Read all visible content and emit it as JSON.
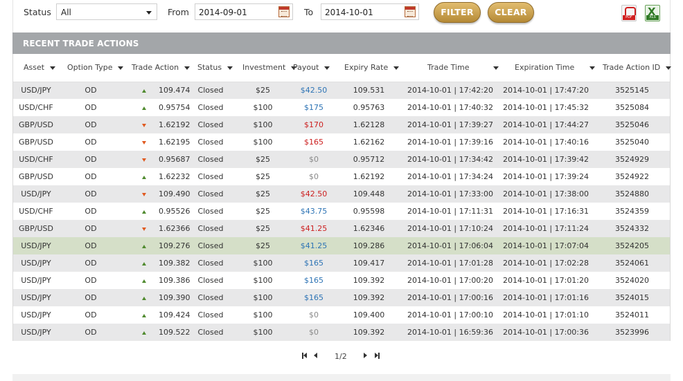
{
  "filters": {
    "status_label": "Status",
    "status_value": "All",
    "from_label": "From",
    "from_value": "2014-09-01",
    "to_label": "To",
    "to_value": "2014-10-01",
    "filter_button": "FILTER",
    "clear_button": "CLEAR",
    "pdf_icon_text": "PDF",
    "xls_icon_text": "XLS"
  },
  "section": {
    "title": "RECENT TRADE ACTIONS"
  },
  "columns": [
    "Asset",
    "Option Type",
    "Trade Action",
    "Status",
    "Investment",
    "Payout",
    "Expiry Rate",
    "Trade Time",
    "Expiration Time",
    "Trade Action ID"
  ],
  "rows": [
    {
      "asset": "USD/JPY",
      "option_type": "OD",
      "direction": "up",
      "trade_action": "109.474",
      "status": "Closed",
      "investment": "$25",
      "payout": "$42.50",
      "payout_color": "blue",
      "expiry_rate": "109.531",
      "trade_time": "2014-10-01 | 17:42:20",
      "expiration_time": "2014-10-01 | 17:47:20",
      "id": "3525145"
    },
    {
      "asset": "USD/CHF",
      "option_type": "OD",
      "direction": "up",
      "trade_action": "0.95754",
      "status": "Closed",
      "investment": "$100",
      "payout": "$175",
      "payout_color": "blue",
      "expiry_rate": "0.95763",
      "trade_time": "2014-10-01 | 17:40:32",
      "expiration_time": "2014-10-01 | 17:45:32",
      "id": "3525084"
    },
    {
      "asset": "GBP/USD",
      "option_type": "OD",
      "direction": "down",
      "trade_action": "1.62192",
      "status": "Closed",
      "investment": "$100",
      "payout": "$170",
      "payout_color": "red",
      "expiry_rate": "1.62128",
      "trade_time": "2014-10-01 | 17:39:27",
      "expiration_time": "2014-10-01 | 17:44:27",
      "id": "3525046"
    },
    {
      "asset": "GBP/USD",
      "option_type": "OD",
      "direction": "down",
      "trade_action": "1.62195",
      "status": "Closed",
      "investment": "$100",
      "payout": "$165",
      "payout_color": "red",
      "expiry_rate": "1.62162",
      "trade_time": "2014-10-01 | 17:39:16",
      "expiration_time": "2014-10-01 | 17:40:16",
      "id": "3525040"
    },
    {
      "asset": "USD/CHF",
      "option_type": "OD",
      "direction": "down",
      "trade_action": "0.95687",
      "status": "Closed",
      "investment": "$25",
      "payout": "$0",
      "payout_color": "gray",
      "expiry_rate": "0.95712",
      "trade_time": "2014-10-01 | 17:34:42",
      "expiration_time": "2014-10-01 | 17:39:42",
      "id": "3524929"
    },
    {
      "asset": "GBP/USD",
      "option_type": "OD",
      "direction": "up",
      "trade_action": "1.62232",
      "status": "Closed",
      "investment": "$25",
      "payout": "$0",
      "payout_color": "gray",
      "expiry_rate": "1.62192",
      "trade_time": "2014-10-01 | 17:34:24",
      "expiration_time": "2014-10-01 | 17:39:24",
      "id": "3524922"
    },
    {
      "asset": "USD/JPY",
      "option_type": "OD",
      "direction": "down",
      "trade_action": "109.490",
      "status": "Closed",
      "investment": "$25",
      "payout": "$42.50",
      "payout_color": "red",
      "expiry_rate": "109.448",
      "trade_time": "2014-10-01 | 17:33:00",
      "expiration_time": "2014-10-01 | 17:38:00",
      "id": "3524880"
    },
    {
      "asset": "USD/CHF",
      "option_type": "OD",
      "direction": "up",
      "trade_action": "0.95526",
      "status": "Closed",
      "investment": "$25",
      "payout": "$43.75",
      "payout_color": "blue",
      "expiry_rate": "0.95598",
      "trade_time": "2014-10-01 | 17:11:31",
      "expiration_time": "2014-10-01 | 17:16:31",
      "id": "3524359"
    },
    {
      "asset": "GBP/USD",
      "option_type": "OD",
      "direction": "down",
      "trade_action": "1.62366",
      "status": "Closed",
      "investment": "$25",
      "payout": "$41.25",
      "payout_color": "red",
      "expiry_rate": "1.62346",
      "trade_time": "2014-10-01 | 17:10:24",
      "expiration_time": "2014-10-01 | 17:11:24",
      "id": "3524332"
    },
    {
      "asset": "USD/JPY",
      "option_type": "OD",
      "direction": "up",
      "trade_action": "109.276",
      "status": "Closed",
      "investment": "$25",
      "payout": "$41.25",
      "payout_color": "blue",
      "expiry_rate": "109.286",
      "trade_time": "2014-10-01 | 17:06:04",
      "expiration_time": "2014-10-01 | 17:07:04",
      "id": "3524205",
      "highlighted": true
    },
    {
      "asset": "USD/JPY",
      "option_type": "OD",
      "direction": "up",
      "trade_action": "109.382",
      "status": "Closed",
      "investment": "$100",
      "payout": "$165",
      "payout_color": "blue",
      "expiry_rate": "109.417",
      "trade_time": "2014-10-01 | 17:01:28",
      "expiration_time": "2014-10-01 | 17:02:28",
      "id": "3524061"
    },
    {
      "asset": "USD/JPY",
      "option_type": "OD",
      "direction": "up",
      "trade_action": "109.386",
      "status": "Closed",
      "investment": "$100",
      "payout": "$165",
      "payout_color": "blue",
      "expiry_rate": "109.392",
      "trade_time": "2014-10-01 | 17:00:20",
      "expiration_time": "2014-10-01 | 17:01:20",
      "id": "3524020"
    },
    {
      "asset": "USD/JPY",
      "option_type": "OD",
      "direction": "up",
      "trade_action": "109.390",
      "status": "Closed",
      "investment": "$100",
      "payout": "$165",
      "payout_color": "blue",
      "expiry_rate": "109.392",
      "trade_time": "2014-10-01 | 17:00:16",
      "expiration_time": "2014-10-01 | 17:01:16",
      "id": "3524015"
    },
    {
      "asset": "USD/JPY",
      "option_type": "OD",
      "direction": "up",
      "trade_action": "109.424",
      "status": "Closed",
      "investment": "$100",
      "payout": "$0",
      "payout_color": "gray",
      "expiry_rate": "109.400",
      "trade_time": "2014-10-01 | 17:00:10",
      "expiration_time": "2014-10-01 | 17:01:10",
      "id": "3524011"
    },
    {
      "asset": "USD/JPY",
      "option_type": "OD",
      "direction": "up",
      "trade_action": "109.522",
      "status": "Closed",
      "investment": "$100",
      "payout": "$0",
      "payout_color": "gray",
      "expiry_rate": "109.392",
      "trade_time": "2014-10-01 | 16:59:36",
      "expiration_time": "2014-10-01 | 17:00:36",
      "id": "3523996"
    }
  ],
  "pagination": {
    "page_text": "1/2"
  },
  "colors": {
    "header_bar": "#a3a6a9",
    "row_alt": "#e8e8e9",
    "row_highlight": "#d5dfc8",
    "payout_win": "#2e74b5",
    "payout_loss": "#cc1f1f",
    "payout_zero": "#8a8a8a",
    "arrow_up": "#4f8a2e",
    "arrow_down": "#e05a20",
    "button_gold": "#c9a04f"
  }
}
